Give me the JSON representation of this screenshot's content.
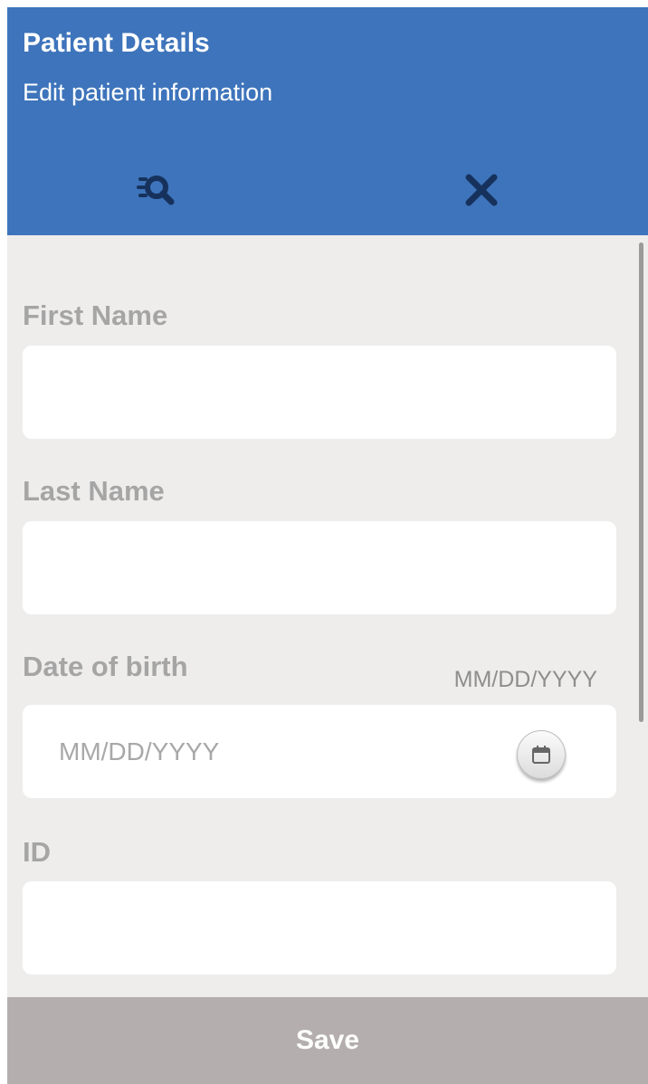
{
  "header": {
    "title": "Patient Details",
    "subtitle": "Edit patient information",
    "accent_color": "#3e74bb",
    "icon_color": "#16325c",
    "actions": [
      "search-icon",
      "close-icon"
    ]
  },
  "form": {
    "first_name": {
      "label": "First Name",
      "value": "",
      "placeholder": ""
    },
    "last_name": {
      "label": "Last Name",
      "value": "",
      "placeholder": ""
    },
    "dob": {
      "label": "Date of birth",
      "format_hint": "MM/DD/YYYY",
      "placeholder": "MM/DD/YYYY",
      "icon": "calendar-icon"
    },
    "id": {
      "label": "ID",
      "value": "",
      "placeholder": ""
    }
  },
  "footer": {
    "save_label": "Save",
    "background": "#b4afae"
  }
}
